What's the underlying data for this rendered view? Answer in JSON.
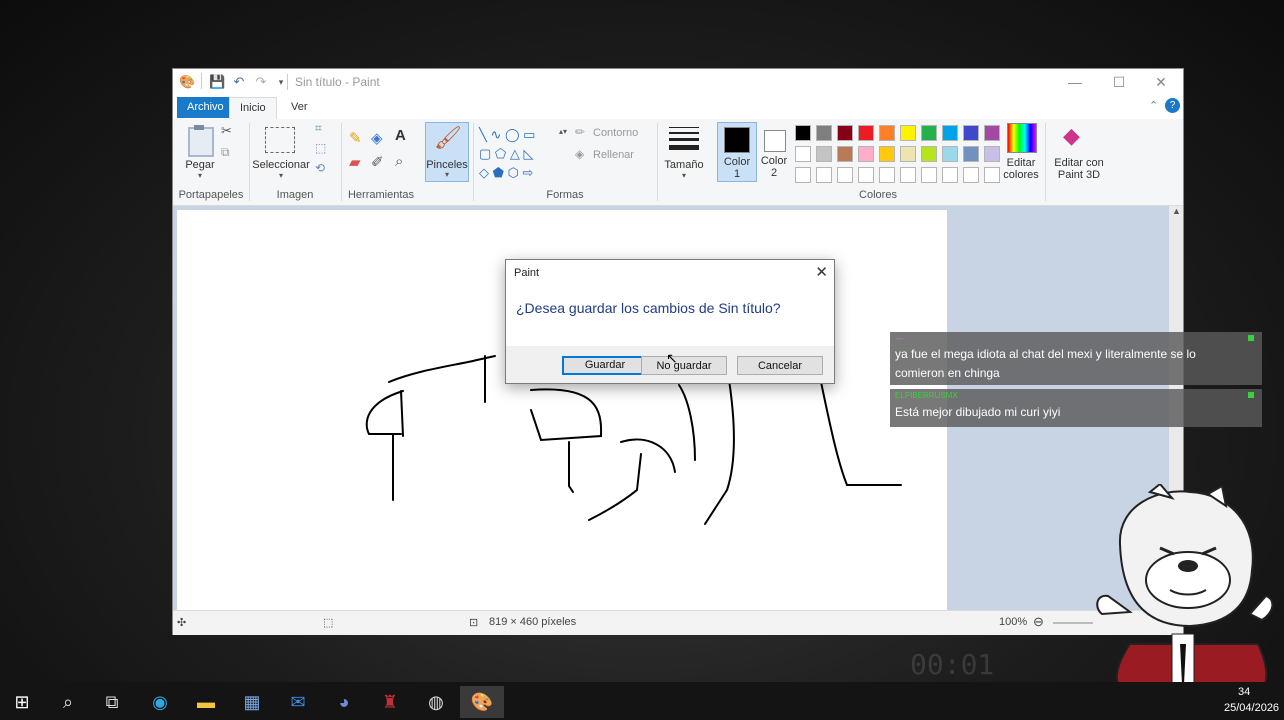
{
  "window": {
    "title": "Sin título - Paint",
    "controls": {
      "minimize": "—",
      "maximize": "☐",
      "close": "✕"
    }
  },
  "tabs": [
    "Archivo",
    "Inicio",
    "Ver"
  ],
  "ribbon": {
    "portapapeles": {
      "label": "Portapapeles",
      "pegar": "Pegar"
    },
    "imagen": {
      "label": "Imagen",
      "seleccionar": "Seleccionar"
    },
    "herramientas": {
      "label": "Herramientas"
    },
    "pinceles": "Pinceles",
    "formas": {
      "label": "Formas",
      "contorno": "Contorno",
      "rellenar": "Rellenar"
    },
    "tamano": "Tamaño",
    "color1": [
      "Color",
      "1"
    ],
    "color2": [
      "Color",
      "2"
    ],
    "colores": {
      "label": "Colores"
    },
    "editar_colores": [
      "Editar",
      "colores"
    ],
    "paint3d": [
      "Editar con",
      "Paint 3D"
    ],
    "palette_row1": [
      "#000000",
      "#7f7f7f",
      "#880015",
      "#ed1c24",
      "#ff7f27",
      "#fff200",
      "#22b14c",
      "#00a2e8",
      "#3f48cc",
      "#a349a4"
    ],
    "palette_row2": [
      "#ffffff",
      "#c3c3c3",
      "#b97a57",
      "#ffaec9",
      "#ffc90e",
      "#efe4b0",
      "#b5e61d",
      "#99d9ea",
      "#7092be",
      "#c8bfe7"
    ]
  },
  "status": {
    "size": "819 × 460 píxeles",
    "zoom": "100%"
  },
  "dialog": {
    "title": "Paint",
    "message": "¿Desea guardar los cambios de Sin título?",
    "buttons": {
      "save": "Guardar",
      "dont_save": "No guardar",
      "cancel": "Cancelar"
    }
  },
  "chat": [
    {
      "user": "—",
      "text_line1": "ya fue el mega idiota al chat del mexi y literalmente se lo",
      "text_line2": "comieron en chinga"
    },
    {
      "user": "ELPIBERRUSMX",
      "text_line1": "Está mejor dibujado mi curi yiyi"
    }
  ],
  "clock": {
    "time": "34",
    "date": "25/04/2026"
  },
  "overlay_timer": "00:01"
}
